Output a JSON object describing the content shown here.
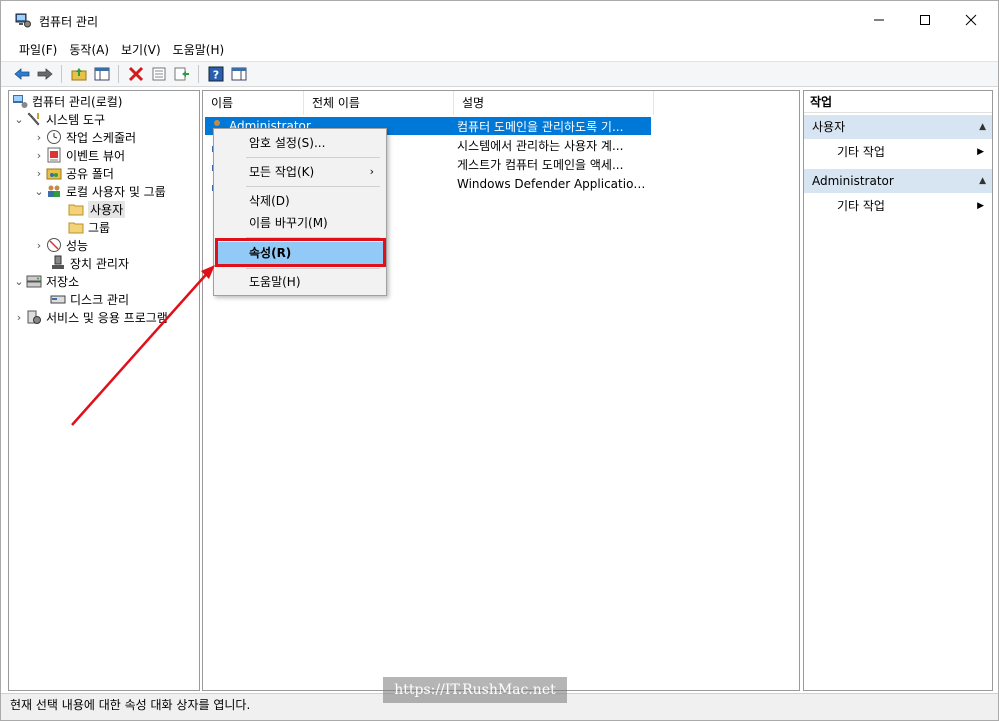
{
  "window": {
    "title": "컴퓨터 관리",
    "minimize_icon": "minimize-icon",
    "maximize_icon": "maximize-icon",
    "close_icon": "close-icon"
  },
  "menu": [
    "파일(F)",
    "동작(A)",
    "보기(V)",
    "도움말(H)"
  ],
  "toolbar": {
    "icons": [
      "back-arrow-icon",
      "forward-arrow-icon",
      "up-folder-icon",
      "show-hide-tree-icon",
      "delete-icon",
      "properties-icon",
      "export-list-icon",
      "help-icon",
      "show-hide-action-pane-icon"
    ]
  },
  "tree": {
    "root": "컴퓨터 관리(로컬)",
    "system_tools": "시스템 도구",
    "task_scheduler": "작업 스케줄러",
    "event_viewer": "이벤트 뷰어",
    "shared_folders": "공유 폴더",
    "local_users_groups": "로컬 사용자 및 그룹",
    "users": "사용자",
    "groups": "그룹",
    "performance": "성능",
    "device_manager": "장치 관리자",
    "storage": "저장소",
    "disk_management": "디스크 관리",
    "services_apps": "서비스 및 응용 프로그램"
  },
  "list": {
    "columns": [
      "이름",
      "전체 이름",
      "설명"
    ],
    "rows": [
      {
        "name": "Administrator",
        "description": "컴퓨터 도메인을 관리하도록 기..."
      },
      {
        "name": "",
        "description": "시스템에서 관리하는 사용자 계..."
      },
      {
        "name": "",
        "description": "게스트가 컴퓨터 도메인을 액세..."
      },
      {
        "name": "",
        "description": "Windows Defender Application G..."
      }
    ]
  },
  "context_menu": {
    "set_password": "암호 설정(S)...",
    "all_tasks": "모든 작업(K)",
    "delete": "삭제(D)",
    "rename": "이름 바꾸기(M)",
    "properties": "속성(R)",
    "help": "도움말(H)"
  },
  "actions": {
    "title": "작업",
    "section1": "사용자",
    "section1_item": "기타 작업",
    "section2": "Administrator",
    "section2_item": "기타 작업"
  },
  "status": "현재 선택 내용에 대한 속성 대화 상자를 엽니다.",
  "watermark": "https://IT.RushMac.net",
  "annotation_color": "#e0101a",
  "selection_color": "#0078d7"
}
